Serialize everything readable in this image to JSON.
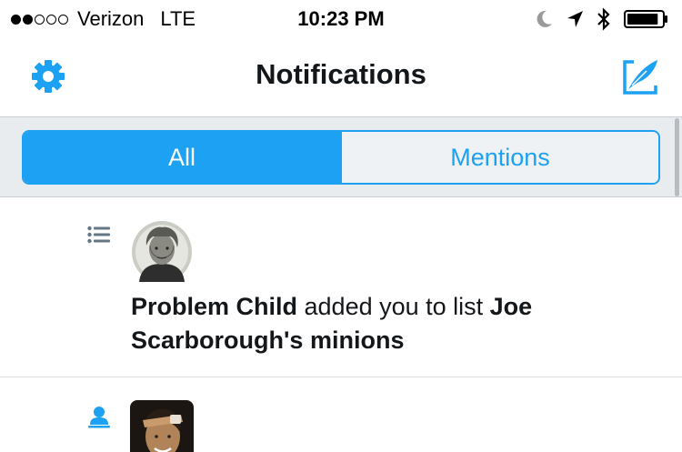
{
  "status_bar": {
    "signal_dots_filled": 2,
    "signal_dots_total": 5,
    "carrier": "Verizon",
    "network": "LTE",
    "time": "10:23 PM",
    "icons": [
      "moon-icon",
      "location-arrow-icon",
      "bluetooth-icon",
      "battery-icon"
    ],
    "battery_level": 0.9
  },
  "nav": {
    "title": "Notifications",
    "left_icon": "gear-icon",
    "right_icon": "compose-icon",
    "accent_color": "#1da1f2"
  },
  "tabs": {
    "items": [
      {
        "label": "All",
        "selected": true
      },
      {
        "label": "Mentions",
        "selected": false
      }
    ]
  },
  "notifications": [
    {
      "type_icon": "list-icon",
      "avatar": "avatar-banknote-portrait",
      "user": "Problem Child",
      "action": " added you to list ",
      "target": "Joe Scarborough's minions"
    },
    {
      "type_icon": "follow-person-icon",
      "avatar": "avatar-person-photo"
    }
  ]
}
